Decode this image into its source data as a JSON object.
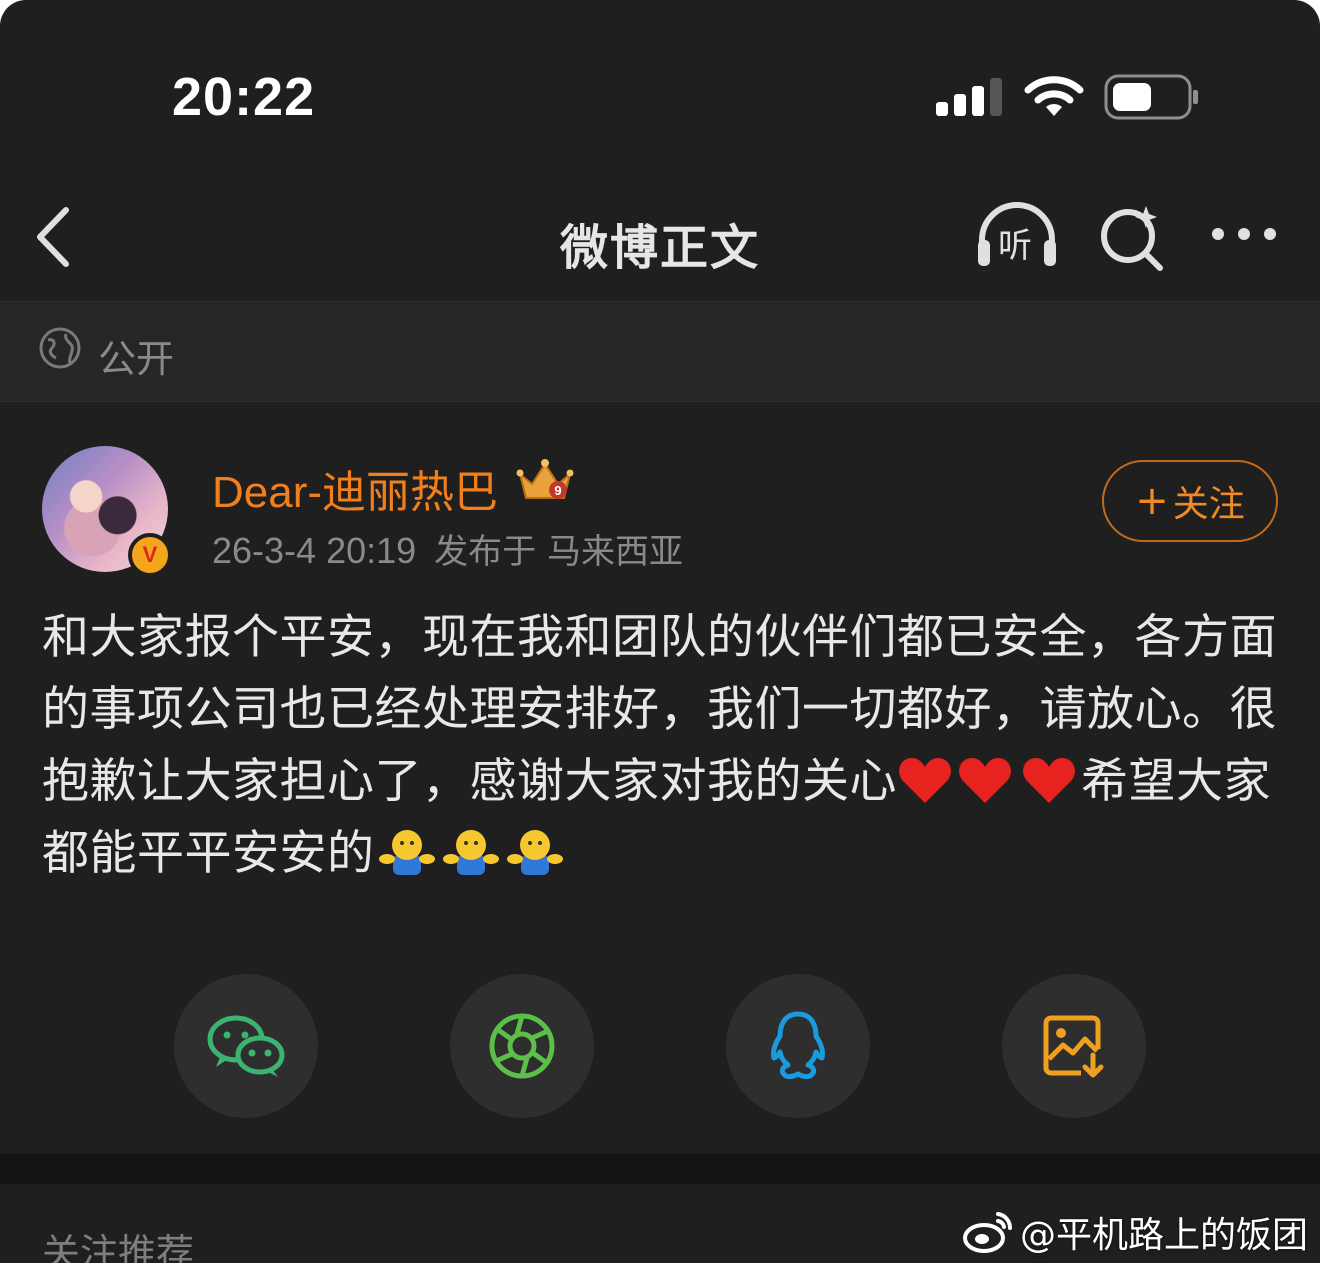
{
  "status_bar": {
    "time": "20:22"
  },
  "nav": {
    "title": "微博正文",
    "listen_label": "听"
  },
  "visibility": {
    "label": "公开"
  },
  "post": {
    "author": "Dear-迪丽热巴",
    "crown_level": "9",
    "verified_mark": "V",
    "timestamp": "26-3-4 20:19",
    "location": "发布于 马来西亚",
    "follow_plus": "+",
    "follow_label": "关注",
    "text_part1": "和大家报个平安，现在我和团队的伙伴们都已安全，各方面的事项公司也已经处理安排好，我们一切都好，请放心。很抱歉让大家担心了，感谢大家对我的关心",
    "text_part2": "希望大家都能平平安安的"
  },
  "share": {
    "items": [
      "wechat-icon",
      "moments-icon",
      "qq-icon",
      "save-image-icon"
    ]
  },
  "recommend": {
    "label": "关注推荐"
  },
  "watermark": {
    "text": "@平机路上的饭团"
  },
  "colors": {
    "accent": "#f07f1c",
    "background": "#1f1f1f",
    "wechat": "#3cb371",
    "moments": "#5bbf4a",
    "qq": "#1a9be0",
    "save": "#f0a020"
  }
}
